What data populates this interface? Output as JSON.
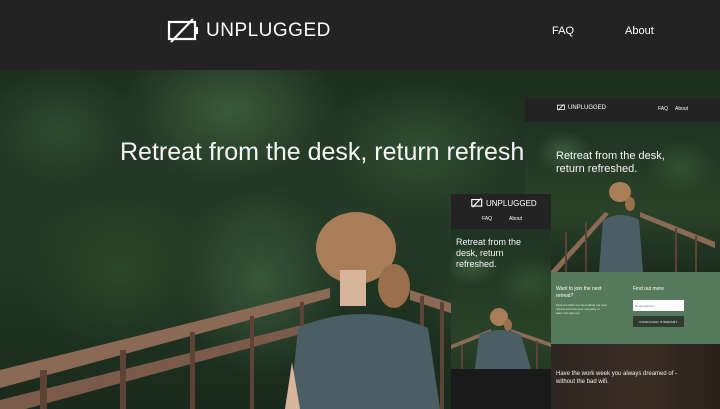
{
  "brand": {
    "name": "UNPLUGGED"
  },
  "nav": [
    {
      "label": "FAQ"
    },
    {
      "label": "About"
    }
  ],
  "hero": {
    "headline": "Retreat from the desk, return refreshed."
  },
  "mobile": {
    "headline_lines": [
      "Retreat from the",
      "desk, return",
      "refreshed."
    ]
  },
  "tablet": {
    "headline_lines": [
      "Retreat from the desk,",
      "return refreshed."
    ],
    "signup": {
      "heading_lines": [
        "Want to join the next",
        "retreat?"
      ],
      "body_lines": [
        "Find out when we are holding our next",
        "retreat and how your company or",
        "team can sign up!"
      ],
      "side_heading": "Find out more",
      "email_placeholder": "Email address",
      "button_label": "DOWNLOAD ITINERARY"
    },
    "tagline_lines": [
      "Have the work week you always dreamed of -",
      "without the bad wifi."
    ]
  },
  "colors": {
    "header_bg": "#232323",
    "accent_green": "#55795a",
    "button_dark": "#2e3b31"
  },
  "icons": {
    "logo": "unplugged-battery-slash-icon"
  }
}
